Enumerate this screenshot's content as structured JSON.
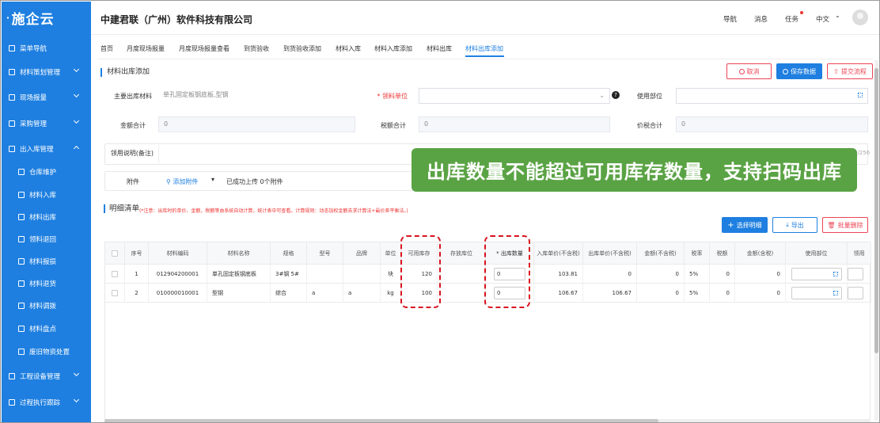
{
  "logo": {
    "text": "施企云"
  },
  "company": "中建君联（广州）软件科技有限公司",
  "topbar": {
    "nav": "导航",
    "messages": "消息",
    "tasks": "任务",
    "lang": "中文"
  },
  "sidebar": {
    "menu": "菜单导航",
    "items": [
      "材料策划管理",
      "现场报量",
      "采购管理",
      "出入库管理"
    ],
    "sub": [
      "仓库维护",
      "材料入库",
      "材料出库",
      "领料退回",
      "材料报损",
      "材料退货",
      "材料调拨",
      "材料盘点",
      "废旧物资处置"
    ],
    "items2": [
      "工程设备管理",
      "过程执行跟踪"
    ]
  },
  "tabs": [
    "首页",
    "月度现场报量",
    "月度现场报量查看",
    "到货验收",
    "到货验收添加",
    "材料入库",
    "材料入库添加",
    "材料出库",
    "材料出库添加"
  ],
  "page": {
    "title": "材料出库添加",
    "cancel": "取消",
    "save": "保存数据",
    "submit": "提交流程"
  },
  "form": {
    "main_material_label": "主要出库材料",
    "main_material_value": "单孔固定板钢底板,型钢",
    "unit_label": "* 领料单位",
    "use_dept_label": "使用部位",
    "amount_label": "金额合计",
    "amount_value": "0",
    "tax_label": "税额合计",
    "tax_value": "0",
    "total_label": "价税合计",
    "total_value": "0",
    "remark_label": "领用说明(备注)",
    "remark_count": "0/256",
    "attach_label": "附件",
    "attach_btn": "添加附件",
    "attach_status": "已成功上传 0个附件"
  },
  "detail": {
    "title": "明细清单",
    "note": "(*注意：出库时的单价、金额，税额等由系统自动计算，统计表中可查看。计算规则：动态加权金额去求计算法+最价差平衡法。)",
    "select_btn": "选择明细",
    "export_btn": "导出",
    "delete_btn": "批量删除"
  },
  "table": {
    "headers": [
      "",
      "序号",
      "材料编码",
      "材料名称",
      "规格",
      "型号",
      "品牌",
      "单位",
      "可用库存",
      "存放库位",
      "* 出库数量",
      "入库单价(不含税)",
      "出库单价(不含税)",
      "金额(不含税)",
      "税率",
      "税额",
      "金额(含税)",
      "使用部位",
      "领用"
    ],
    "rows": [
      [
        "",
        "1",
        "012904200001",
        "单孔固定板钢底板",
        "3#钢 5#",
        "",
        "",
        "块",
        "120",
        "",
        "0",
        "103.81",
        "0",
        "0",
        "5%",
        "0",
        "0",
        "",
        ""
      ],
      [
        "",
        "2",
        "010000010001",
        "型钢",
        "综合",
        "a",
        "a",
        "kg",
        "100",
        "",
        "0",
        "106.67",
        "106.67",
        "0",
        "5%",
        "0",
        "0",
        "",
        ""
      ]
    ]
  },
  "banner": "出库数量不能超过可用库存数量，支持扫码出库"
}
